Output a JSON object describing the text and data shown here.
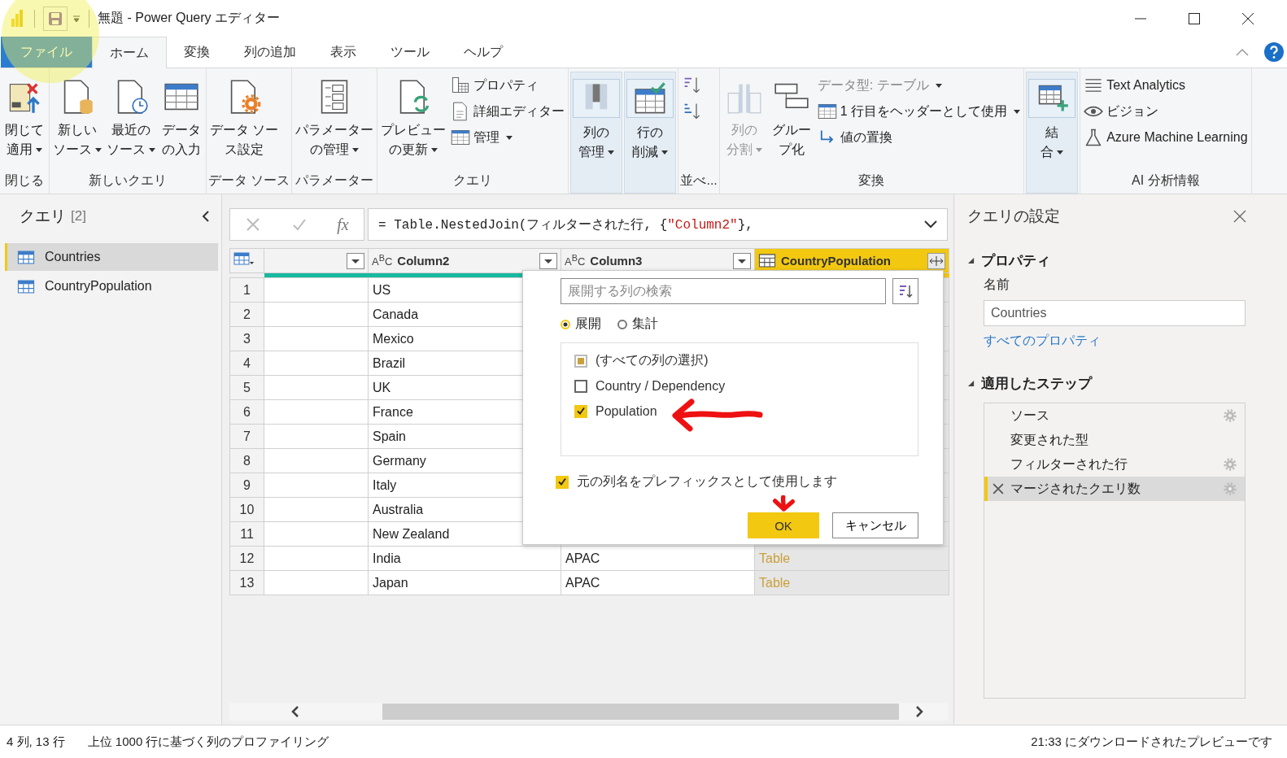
{
  "window": {
    "title": "無題 - Power Query エディター"
  },
  "tabs": [
    {
      "label": "ファイル",
      "kind": "file",
      "selected": false
    },
    {
      "label": "ホーム",
      "kind": "tab",
      "selected": true
    },
    {
      "label": "変換",
      "kind": "tab",
      "selected": false
    },
    {
      "label": "列の追加",
      "kind": "tab",
      "selected": false
    },
    {
      "label": "表示",
      "kind": "tab",
      "selected": false
    },
    {
      "label": "ツール",
      "kind": "tab",
      "selected": false
    },
    {
      "label": "ヘルプ",
      "kind": "tab",
      "selected": false
    }
  ],
  "ribbon": {
    "groups": [
      {
        "label": "閉じる",
        "items": [
          {
            "kind": "large",
            "lines": [
              "閉じて",
              "適用"
            ],
            "dropdown": true,
            "disabled": false,
            "highlighted": false
          }
        ]
      },
      {
        "label": "新しいクエリ",
        "items": [
          {
            "kind": "large",
            "lines": [
              "新しい",
              "ソース"
            ],
            "dropdown": true,
            "disabled": false,
            "highlighted": false
          },
          {
            "kind": "large",
            "lines": [
              "最近の",
              "ソース"
            ],
            "dropdown": true,
            "disabled": false,
            "highlighted": false
          },
          {
            "kind": "large",
            "lines": [
              "データ",
              "の入力"
            ],
            "dropdown": false,
            "disabled": false,
            "highlighted": false
          }
        ]
      },
      {
        "label": "データ ソース",
        "items": [
          {
            "kind": "large",
            "lines": [
              "データ ソー",
              "ス設定"
            ],
            "dropdown": false,
            "disabled": false,
            "highlighted": false
          }
        ]
      },
      {
        "label": "パラメーター",
        "items": [
          {
            "kind": "large",
            "lines": [
              "パラメーター",
              "の管理"
            ],
            "dropdown": true,
            "disabled": false,
            "highlighted": false
          }
        ]
      },
      {
        "label": "クエリ",
        "items": [
          {
            "kind": "large",
            "lines": [
              "プレビュー",
              "の更新"
            ],
            "dropdown": true,
            "disabled": false,
            "highlighted": false
          },
          {
            "kind": "stack",
            "items": [
              {
                "label": "プロパティ",
                "dropdown": false,
                "disabled": false
              },
              {
                "label": "詳細エディター",
                "dropdown": false,
                "disabled": false
              },
              {
                "label": "管理",
                "dropdown": true,
                "disabled": false
              }
            ]
          }
        ]
      },
      {
        "items": [
          {
            "kind": "large",
            "lines": [
              "列の",
              "管理"
            ],
            "dropdown": true,
            "disabled": false,
            "highlighted": true
          },
          {
            "kind": "large",
            "lines": [
              "行の",
              "削減"
            ],
            "dropdown": true,
            "disabled": false,
            "highlighted": true
          }
        ]
      },
      {
        "label": "並べ...",
        "items": [
          {
            "kind": "stack",
            "items": [
              {
                "dropdown": false,
                "disabled": false
              },
              {
                "dropdown": false,
                "disabled": false
              }
            ]
          }
        ]
      },
      {
        "label": "変換",
        "items": [
          {
            "kind": "large",
            "lines": [
              "列の",
              "分割"
            ],
            "dropdown": true,
            "disabled": true,
            "highlighted": false
          },
          {
            "kind": "large",
            "lines": [
              "グルー",
              "プ化"
            ],
            "dropdown": false,
            "disabled": false,
            "highlighted": false
          },
          {
            "kind": "stack",
            "items": [
              {
                "label": "データ型: テーブル",
                "dropdown": true,
                "disabled": true
              },
              {
                "label": "1 行目をヘッダーとして使用",
                "dropdown": true,
                "disabled": false
              },
              {
                "label": "値の置換",
                "dropdown": false,
                "disabled": false
              }
            ]
          }
        ]
      },
      {
        "items": [
          {
            "kind": "large",
            "lines": [
              "結",
              "合"
            ],
            "dropdown": true,
            "disabled": false,
            "highlighted": true
          }
        ]
      },
      {
        "label": "AI 分析情報",
        "items": [
          {
            "kind": "stack",
            "items": [
              {
                "label": "Text Analytics",
                "dropdown": false,
                "disabled": false
              },
              {
                "label": "ビジョン",
                "dropdown": false,
                "disabled": false
              },
              {
                "label": "Azure Machine Learning",
                "dropdown": false,
                "disabled": false
              }
            ]
          }
        ]
      }
    ]
  },
  "queries_panel": {
    "title": "クエリ",
    "count": "[2]",
    "items": [
      {
        "label": "Countries",
        "selected": true
      },
      {
        "label": "CountryPopulation",
        "selected": false
      }
    ]
  },
  "formula_bar": {
    "fx": "fx",
    "parts": [
      {
        "kind": "code",
        "text": "= Table.NestedJoin(フィルターされた行, {"
      },
      {
        "kind": "string",
        "text": "\"Column2\""
      },
      {
        "kind": "code",
        "text": "},"
      }
    ]
  },
  "table": {
    "columns": [
      {
        "kind": "any"
      },
      {
        "kind": "text",
        "type_glyph": "A$^{B}$C",
        "label": "Column2",
        "selected": false
      },
      {
        "kind": "text",
        "type_glyph": "A$^{B}$C",
        "label": "Column3",
        "selected": false
      },
      {
        "kind": "table",
        "label": "CountryPopulation",
        "selected": true
      }
    ],
    "rows": [
      {
        "index": "1",
        "column2": "US"
      },
      {
        "index": "2",
        "column2": "Canada"
      },
      {
        "index": "3",
        "column2": "Mexico"
      },
      {
        "index": "4",
        "column2": "Brazil"
      },
      {
        "index": "5",
        "column2": "UK"
      },
      {
        "index": "6",
        "column2": "France"
      },
      {
        "index": "7",
        "column2": "Spain"
      },
      {
        "index": "8",
        "column2": "Germany"
      },
      {
        "index": "9",
        "column2": "Italy"
      },
      {
        "index": "10",
        "column2": "Australia"
      },
      {
        "index": "11",
        "column2": "New Zealand"
      },
      {
        "index": "12",
        "column2": "India",
        "column3": "APAC",
        "column4": "Table"
      },
      {
        "index": "13",
        "column2": "Japan",
        "column3": "APAC",
        "column4": "Table"
      }
    ]
  },
  "expand_dialog": {
    "search": {
      "placeholder": "展開する列の検索"
    },
    "modes": [
      {
        "label": "展開",
        "selected": true
      },
      {
        "label": "集計",
        "selected": false
      }
    ],
    "columns": [
      {
        "label": "(すべての列の選択)",
        "checked": false,
        "partial": true
      },
      {
        "label": "Country / Dependency",
        "checked": false,
        "partial": false
      },
      {
        "label": "Population",
        "checked": true,
        "partial": false
      }
    ],
    "prefix": {
      "label": "元の列名をプレフィックスとして使用します",
      "checked": true
    },
    "buttons": [
      {
        "label": "OK",
        "kind": "primary"
      },
      {
        "label": "キャンセル",
        "kind": "secondary"
      }
    ]
  },
  "settings_panel": {
    "title": "クエリの設定",
    "properties": {
      "heading": "プロパティ",
      "expanded": true,
      "name_label": "名前",
      "name_value": "Countries",
      "link": "すべてのプロパティ"
    },
    "steps_section": {
      "heading": "適用したステップ",
      "expanded": true
    },
    "steps": [
      {
        "label": "ソース",
        "gear": true,
        "selected": false
      },
      {
        "label": "変更された型",
        "gear": false,
        "selected": false
      },
      {
        "label": "フィルターされた行",
        "gear": true,
        "selected": false
      },
      {
        "label": "マージされたクエリ数",
        "gear": true,
        "selected": true
      }
    ]
  },
  "status_bar": {
    "left": [
      "4 列, 13 行",
      "上位 1000 行に基づく列のプロファイリング"
    ],
    "right": "21:33 にダウンロードされたプレビューです"
  },
  "annotations": [
    {
      "kind": "circle"
    },
    {
      "kind": "arrow-left"
    },
    {
      "kind": "arrow-down"
    }
  ]
}
